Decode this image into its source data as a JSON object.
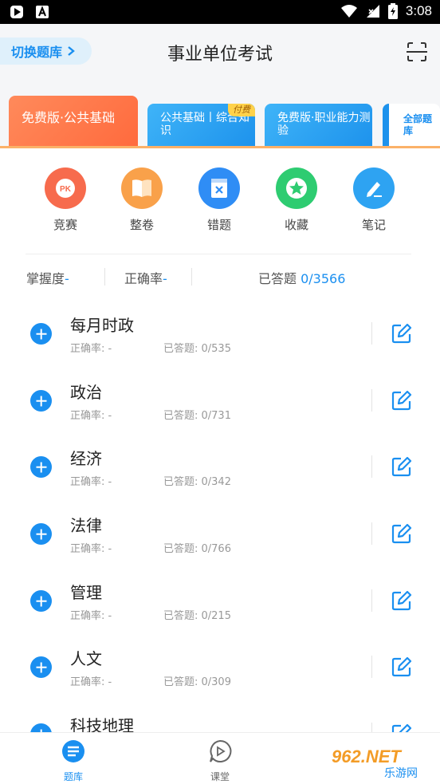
{
  "status_bar": {
    "time": "3:08"
  },
  "header": {
    "switch_label": "切换题库",
    "title": "事业单位考试"
  },
  "tabs": [
    {
      "label": "免费版·公共基础"
    },
    {
      "label": "公共基础丨综合知识",
      "badge": "付费"
    },
    {
      "label": "免费版·职业能力测验"
    },
    {
      "label": "全部题库"
    }
  ],
  "quick_actions": [
    {
      "label": "竞赛",
      "icon": "pk-icon",
      "color": "#f76b4d",
      "glyph": "PK"
    },
    {
      "label": "整卷",
      "icon": "book-icon",
      "color": "#f9a14a"
    },
    {
      "label": "错题",
      "icon": "wrong-question-icon",
      "color": "#2f8df5"
    },
    {
      "label": "收藏",
      "icon": "star-icon",
      "color": "#2ecc71"
    },
    {
      "label": "笔记",
      "icon": "pen-icon",
      "color": "#2ea3f2"
    }
  ],
  "stats": {
    "mastery_label": "掌握度",
    "mastery_value": "-",
    "accuracy_label": "正确率",
    "accuracy_value": "-",
    "answered_label": "已答题",
    "answered_value": "0/3566"
  },
  "categories": [
    {
      "name": "每月时政",
      "accuracy": "正确率: -",
      "answered": "已答题: 0/535"
    },
    {
      "name": "政治",
      "accuracy": "正确率: -",
      "answered": "已答题: 0/731"
    },
    {
      "name": "经济",
      "accuracy": "正确率: -",
      "answered": "已答题: 0/342"
    },
    {
      "name": "法律",
      "accuracy": "正确率: -",
      "answered": "已答题: 0/766"
    },
    {
      "name": "管理",
      "accuracy": "正确率: -",
      "answered": "已答题: 0/215"
    },
    {
      "name": "人文",
      "accuracy": "正确率: -",
      "answered": "已答题: 0/309"
    },
    {
      "name": "科技地理",
      "accuracy": "",
      "answered": ""
    }
  ],
  "bottom_nav": [
    {
      "label": "题库",
      "active": true
    },
    {
      "label": "课堂",
      "active": false
    }
  ],
  "watermark": {
    "text": "962.NET",
    "subtext": "乐游网"
  },
  "colors": {
    "accent": "#1a8ff0",
    "orange": "#ff7a4a"
  }
}
